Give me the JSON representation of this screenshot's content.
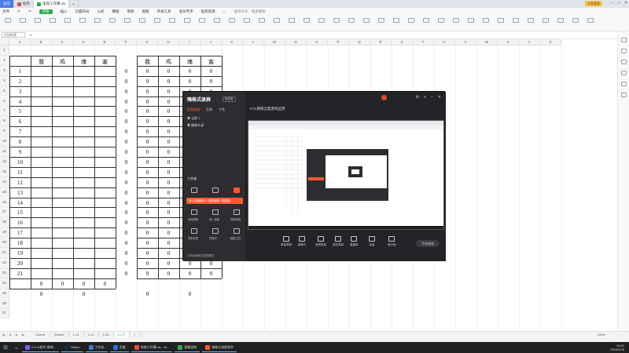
{
  "browser_tabs": [
    {
      "label": "首页",
      "active": false
    },
    {
      "label": "稻壳",
      "active": false
    },
    {
      "label": "电商工作簿.xls",
      "active": true
    }
  ],
  "login_label": "立即登录",
  "menu": {
    "file": "文件",
    "start": "开始",
    "items": [
      "插入",
      "页面布局",
      "公式",
      "数据",
      "审阅",
      "视图",
      "开发工具",
      "会员专享",
      "稻壳资源"
    ],
    "search": "查找命令、搜索模板"
  },
  "namebox": "文档新建",
  "grid": {
    "columns": [
      "A",
      "B",
      "C",
      "D",
      "E",
      "F",
      "G",
      "H",
      "I",
      "J",
      "K",
      "L",
      "M",
      "N",
      "O",
      "P",
      "Q",
      "R",
      "S",
      "T",
      "U",
      "V",
      "W",
      "X",
      "Y",
      "Z"
    ],
    "rows": [
      "1",
      "2",
      "3",
      "4",
      "5",
      "6",
      "7",
      "8",
      "9",
      "10",
      "11",
      "12",
      "13",
      "14",
      "15",
      "16",
      "17",
      "18",
      "19",
      "20",
      "21",
      "22",
      "23",
      "24",
      "25",
      "26",
      "27"
    ],
    "headers_left": [
      "我",
      "鸡",
      "魂",
      "害"
    ],
    "headers_right": [
      "我",
      "鸡",
      "魂",
      "害"
    ],
    "row_numbers": [
      "1",
      "2",
      "3",
      "4",
      "5",
      "6",
      "7",
      "8",
      "9",
      "10",
      "11",
      "12",
      "13",
      "14",
      "15",
      "16",
      "17",
      "18",
      "19",
      "20",
      "21"
    ],
    "zero": "0",
    "bottom_row": [
      "0",
      "0",
      "0",
      "0"
    ],
    "row25": [
      "0",
      "0",
      "0",
      "0"
    ]
  },
  "sheets": [
    "Sheet1",
    "Sheet2",
    "1-14",
    "1-21",
    "1-28",
    "3-1下"
  ],
  "active_sheet": "3-1下",
  "zoom": "100%",
  "overlay": {
    "app_title": "嗨格式录屏",
    "badge": "免费版",
    "tabs": [
      "视频录制",
      "直播",
      "专属"
    ],
    "items": [
      "全屏 1",
      "摄像头录"
    ],
    "right_title": "KYL网络全面游戏运营",
    "tools_title": "工具箱",
    "orange_text": "录入直播每天一场直播看一场直播",
    "tool_labels": [
      "剪辑视频",
      "录入视频",
      "视频转换",
      "录屏设置",
      "转格式",
      "截图工具"
    ],
    "footer_text": "已有其他格式视频格式",
    "bottom_buttons": [
      "屏幕录制",
      "摄像头",
      "音频录制",
      "游戏录制",
      "直播间",
      "绘画",
      "画中画"
    ],
    "start_button": "开始录制"
  },
  "taskbar": [
    "KYLN软件-原神...",
    "Steam",
    "工作站",
    "百度",
    "电商工作簿.xls - W...",
    "直播录制",
    "嗨格式录屏软件"
  ],
  "clock": "10:51",
  "date": "2023/2/28"
}
